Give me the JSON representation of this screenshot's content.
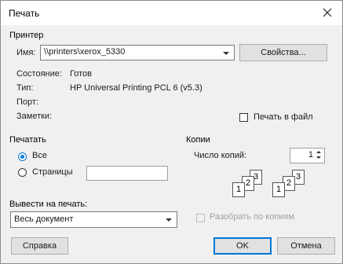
{
  "window": {
    "title": "Печать"
  },
  "printer": {
    "group_label": "Принтер",
    "name_label": "Имя:",
    "name_value": "\\\\printers\\xerox_5330",
    "properties_button": "Свойства...",
    "status_label": "Состояние:",
    "status_value": "Готов",
    "type_label": "Тип:",
    "type_value": "HP Universal Printing PCL 6 (v5.3)",
    "port_label": "Порт:",
    "notes_label": "Заметки:",
    "print_to_file_label": "Печать в файл"
  },
  "print_range": {
    "group_label": "Печатать",
    "all_label": "Все",
    "pages_label": "Страницы",
    "pages_value": ""
  },
  "copies": {
    "group_label": "Копии",
    "count_label": "Число копий:",
    "count_value": "1",
    "collate_label": "Разобрать по копиям",
    "collate_icon_pages": [
      "1",
      "2",
      "3",
      "1",
      "2",
      "3"
    ]
  },
  "output": {
    "label": "Вывести на печать:",
    "value": "Весь документ"
  },
  "buttons": {
    "help": "Справка",
    "ok": "OK",
    "cancel": "Отмена"
  },
  "colors": {
    "accent": "#0078d7"
  }
}
